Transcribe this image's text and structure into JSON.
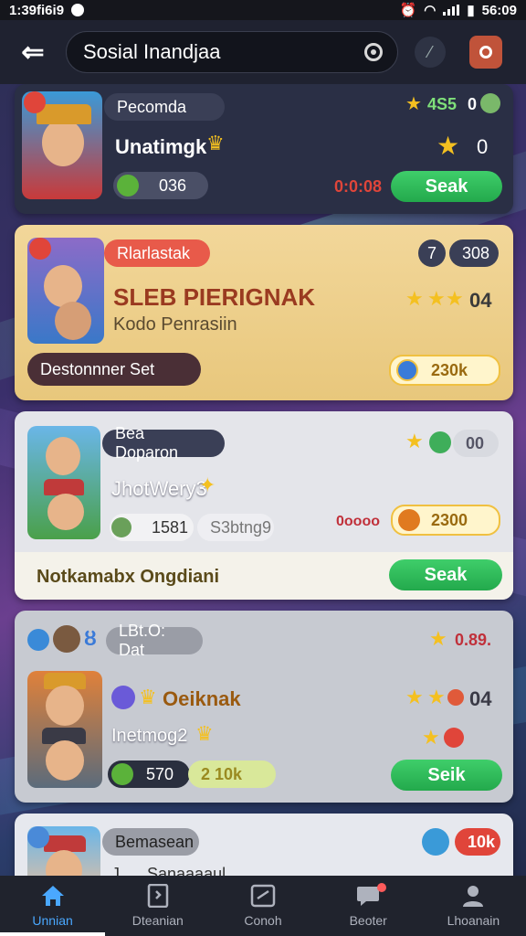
{
  "status_bar": {
    "time_left": "1:39fi6i9",
    "time_right": "56:09"
  },
  "header": {
    "search_text": "Sosial Inandjaa"
  },
  "cards": [
    {
      "tag": "Pecomda",
      "title": "Unatimgk",
      "rating": "4S5",
      "count": "0",
      "circle_val": "0",
      "pill_value": "036",
      "timer": "0:0:08",
      "button": "Seak"
    },
    {
      "tag": "Rlarlastak",
      "title": "SLEB PIERIGNAK",
      "subtitle": "Kodo Penrasiin",
      "badge_num": "7",
      "badge_val": "308",
      "rating_num": "04",
      "dark_pill": "Destonnner Set",
      "coin_value": "230k"
    },
    {
      "tag": "Bea Doparon",
      "title": "JhotWery3",
      "chip_value": "1581",
      "chip_text": "S3btng9",
      "small_text": "0oooo",
      "coin_value": "2300",
      "rating_val": "00",
      "footer_text": "Notkamabx Ongdiani",
      "button": "Seak"
    },
    {
      "tag": "LBt.O: Dat",
      "title": "Oeiknak",
      "subtitle": "Inetmog2",
      "rating": "0.89.",
      "rating_num": "04",
      "pill_value": "570",
      "pill_text": "2 10k",
      "button": "Seik"
    },
    {
      "tag": "Bemasean",
      "badge": "10k",
      "subtitle": "J..... Sanaaaaul"
    }
  ],
  "nav": [
    {
      "label": "Unnian",
      "icon": "home-icon"
    },
    {
      "label": "Dteanian",
      "icon": "document-icon"
    },
    {
      "label": "Conoh",
      "icon": "frame-icon"
    },
    {
      "label": "Beoter",
      "icon": "chat-icon"
    },
    {
      "label": "Lhoanain",
      "icon": "profile-icon"
    }
  ],
  "colors": {
    "accent_green": "#2fbb5a",
    "nav_active": "#4aa8ff",
    "gold_card": "#f2d79a",
    "dark_card": "#2a2f45"
  }
}
